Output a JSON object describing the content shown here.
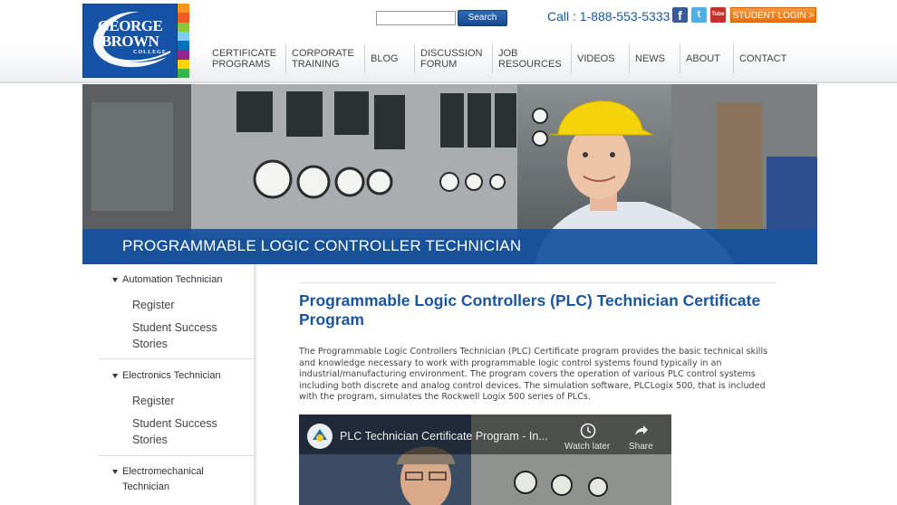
{
  "header": {
    "logo": {
      "line1": "GEORGE",
      "line2": "BROWN",
      "line3": "COLLEGE"
    },
    "search": {
      "value": "",
      "placeholder": "",
      "button_label": "Search"
    },
    "phone": "Call : 1-888-553-5333",
    "social": {
      "facebook": "f",
      "twitter": "t",
      "youtube": "Tube"
    },
    "student_login": "STUDENT LOGIN >",
    "nav": [
      {
        "line1": "CERTIFICATE",
        "line2": "PROGRAMS"
      },
      {
        "line1": "CORPORATE",
        "line2": "TRAINING"
      },
      {
        "line1": "BLOG",
        "line2": ""
      },
      {
        "line1": "DISCUSSION",
        "line2": "FORUM"
      },
      {
        "line1": "JOB",
        "line2": "RESOURCES"
      },
      {
        "line1": "VIDEOS",
        "line2": ""
      },
      {
        "line1": "NEWS",
        "line2": ""
      },
      {
        "line1": "ABOUT",
        "line2": ""
      },
      {
        "line1": "CONTACT",
        "line2": ""
      }
    ]
  },
  "banner": {
    "title": "PROGRAMMABLE LOGIC CONTROLLER TECHNICIAN"
  },
  "sidebar": {
    "groups": [
      {
        "label": "Automation Technician",
        "items": [
          "Register",
          "Student Success Stories"
        ]
      },
      {
        "label": "Electronics Technician",
        "items": [
          "Register",
          "Student Success Stories"
        ]
      },
      {
        "label": "Electromechanical Technician",
        "items": []
      }
    ]
  },
  "main": {
    "title": "Programmable Logic Controllers (PLC) Technician Certificate Program",
    "body": "The Programmable Logic Controllers Technician (PLC) Certificate program provides the basic technical skills and knowledge necessary to work with programmable logic control systems found typically in an industrial/manufacturing environment. The program covers the operation of various PLC control systems including both discrete and analog control devices. The simulation software, PLCLogix 500, that is included with the program, simulates the Rockwell Logix 500 series of PLCs."
  },
  "video": {
    "title": "PLC Technician Certificate Program - In...",
    "watch_later": "Watch later",
    "share": "Share"
  },
  "colors": {
    "brand_blue": "#1453a5",
    "title_blue": "#1a56a0",
    "login_orange": "#f0821e",
    "logo_stripes": [
      "#f7941d",
      "#f15a29",
      "#8dc63f",
      "#7ecbef",
      "#0072bc",
      "#92278f",
      "#ffd200",
      "#39b54a"
    ]
  }
}
